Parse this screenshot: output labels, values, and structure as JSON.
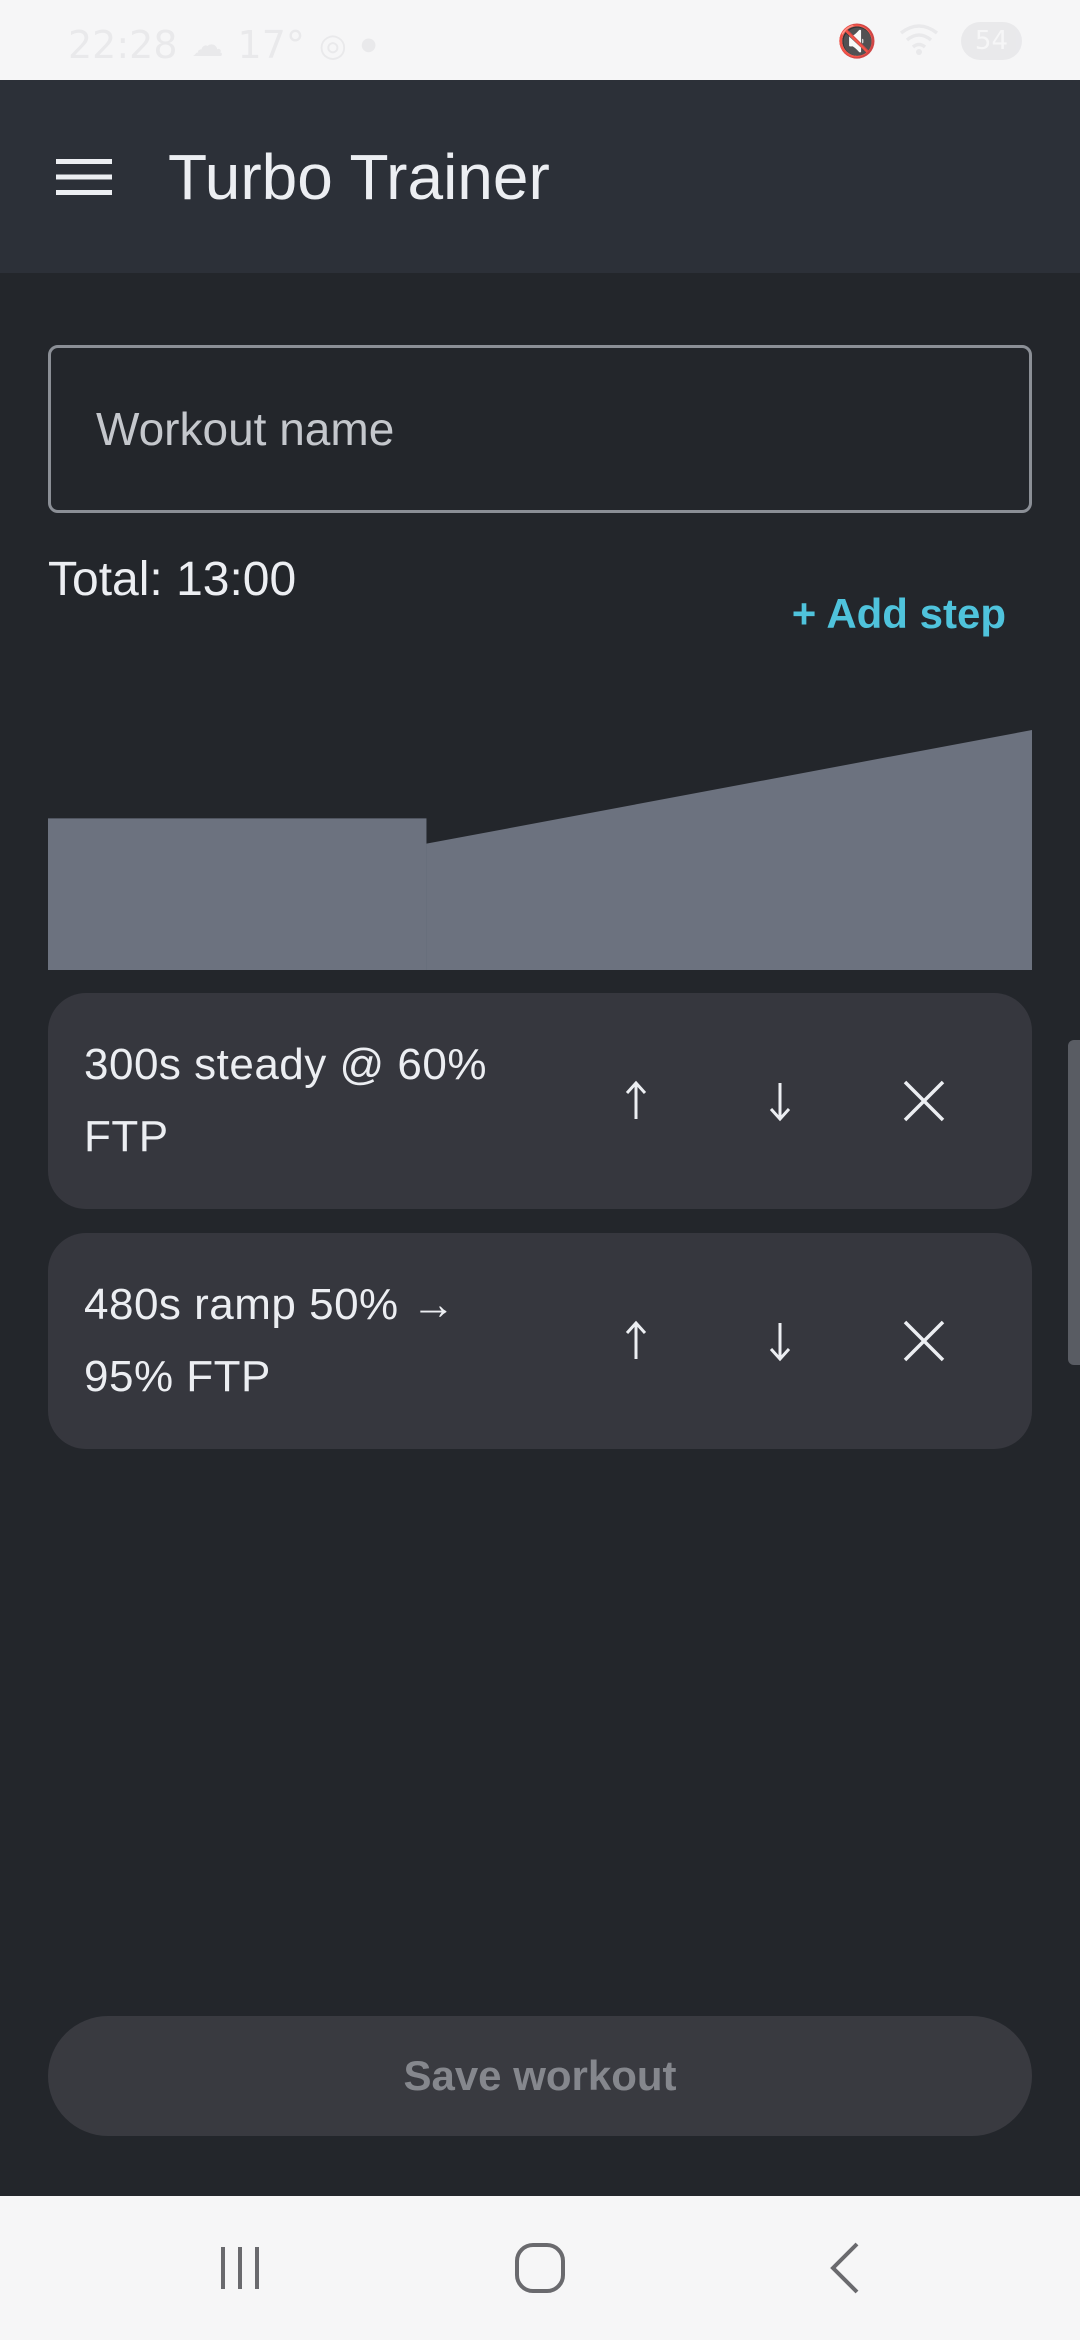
{
  "status_bar": {
    "time": "22:28",
    "temperature": "17°",
    "battery": "54",
    "icons": [
      "cloud-icon",
      "location-icon",
      "dot-icon",
      "mute-icon",
      "wifi-icon",
      "battery-icon"
    ]
  },
  "app_bar": {
    "title": "Turbo Trainer",
    "menu_icon": "menu-icon"
  },
  "workout_name": {
    "placeholder": "Workout name",
    "value": ""
  },
  "total": "Total: 13:00",
  "add_step_label": "+ Add step",
  "chart_data": {
    "type": "area",
    "title": "",
    "xlabel": "",
    "ylabel": "",
    "fill_color": "#6c727f",
    "segments": [
      {
        "kind": "steady",
        "duration_s": 300,
        "start_pct": 60,
        "end_pct": 60
      },
      {
        "kind": "ramp",
        "duration_s": 480,
        "start_pct": 50,
        "end_pct": 95
      }
    ],
    "ylim": [
      0,
      95
    ]
  },
  "steps": [
    {
      "label": "300s steady @ 60% FTP",
      "up_icon": "arrow-up-icon",
      "down_icon": "arrow-down-icon",
      "delete_icon": "close-icon"
    },
    {
      "label": "480s ramp 50% → 95% FTP",
      "up_icon": "arrow-up-icon",
      "down_icon": "arrow-down-icon",
      "delete_icon": "close-icon"
    }
  ],
  "save_label": "Save workout",
  "colors": {
    "background": "#23262b",
    "app_bar": "#2c3038",
    "accent": "#4fc3dc",
    "card": "#36373e",
    "chart_fill": "#6c727f",
    "disabled_button": "#393a40",
    "disabled_text": "#85878d"
  },
  "nav_bar": {
    "icons": [
      "recents-icon",
      "home-icon",
      "back-icon"
    ]
  }
}
